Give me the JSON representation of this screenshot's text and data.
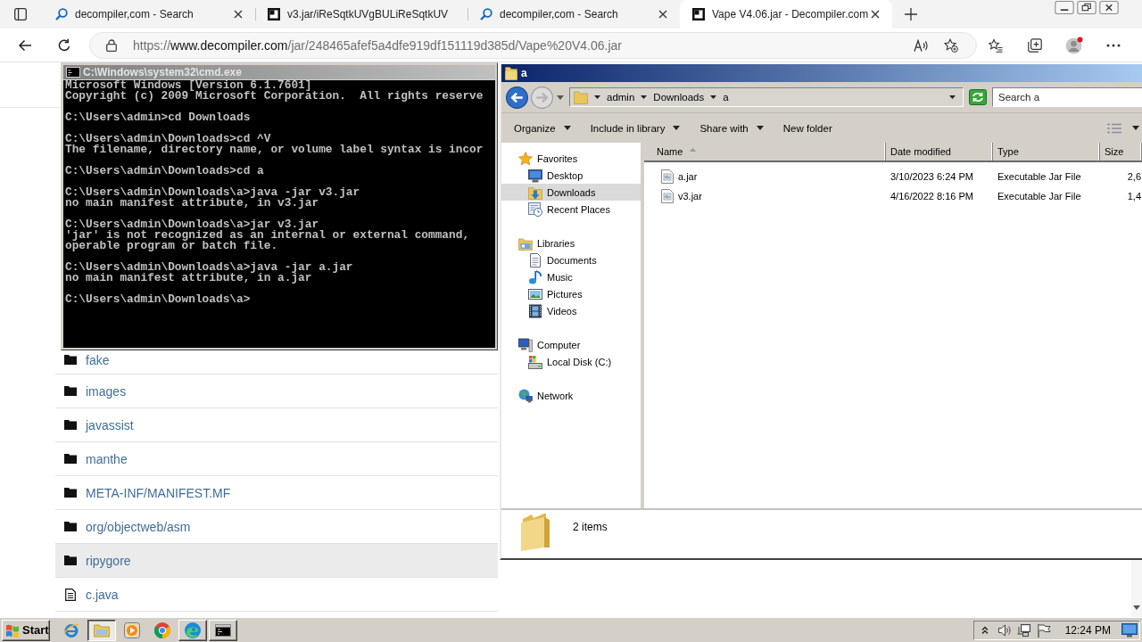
{
  "browser": {
    "tabs": [
      {
        "title": "decompiler,com - Search",
        "kind": "search",
        "selected": false,
        "closable": true
      },
      {
        "title": "v3.jar/iReSqtkUVgBULiReSqtkUV",
        "kind": "site",
        "selected": false,
        "closable": false
      },
      {
        "title": "decompiler,com - Search",
        "kind": "search",
        "selected": false,
        "closable": true
      },
      {
        "title": "Vape V4.06.jar - Decompiler.com",
        "kind": "site",
        "selected": true,
        "closable": true
      }
    ],
    "address": {
      "scheme": "https://",
      "host": "www.decompiler.com",
      "path": "/jar/248465afef5a4dfe919df151119d385d/Vape%20V4.06.jar"
    },
    "listing": [
      {
        "name": "fake",
        "kind": "folder",
        "highlighted": false
      },
      {
        "name": "images",
        "kind": "folder",
        "highlighted": false
      },
      {
        "name": "javassist",
        "kind": "folder",
        "highlighted": false
      },
      {
        "name": "manthe",
        "kind": "folder",
        "highlighted": false
      },
      {
        "name": "META-INF/MANIFEST.MF",
        "kind": "folder",
        "highlighted": false
      },
      {
        "name": "org/objectweb/asm",
        "kind": "folder",
        "highlighted": false
      },
      {
        "name": "ripygore",
        "kind": "folder",
        "highlighted": true
      },
      {
        "name": "c.java",
        "kind": "file",
        "highlighted": false
      }
    ]
  },
  "cmd": {
    "title": "C:\\Windows\\system32\\cmd.exe",
    "blocks": [
      [
        "Microsoft Windows [Version 6.1.7601]",
        "Copyright (c) 2009 Microsoft Corporation.  All rights reserve"
      ],
      [
        "C:\\Users\\admin>cd Downloads"
      ],
      [
        "C:\\Users\\admin\\Downloads>cd ^V",
        "The filename, directory name, or volume label syntax is incor"
      ],
      [
        "C:\\Users\\admin\\Downloads>cd a"
      ],
      [
        "C:\\Users\\admin\\Downloads\\a>java -jar v3.jar",
        "no main manifest attribute, in v3.jar"
      ],
      [
        "C:\\Users\\admin\\Downloads\\a>jar v3.jar",
        "'jar' is not recognized as an internal or external command,",
        "operable program or batch file."
      ],
      [
        "C:\\Users\\admin\\Downloads\\a>java -jar a.jar",
        "no main manifest attribute, in a.jar"
      ],
      [
        "C:\\Users\\admin\\Downloads\\a>"
      ]
    ]
  },
  "explorer": {
    "title": "a",
    "breadcrumb": [
      "admin",
      "Downloads",
      "a"
    ],
    "search": {
      "placeholder": "Search a"
    },
    "toolbar": [
      {
        "label": "Organize",
        "menu": true
      },
      {
        "label": "Include in library",
        "menu": true
      },
      {
        "label": "Share with",
        "menu": true
      },
      {
        "label": "New folder",
        "menu": false
      }
    ],
    "nav": [
      {
        "label": "Favorites",
        "selected": false,
        "children": [
          {
            "label": "Desktop",
            "selected": false
          },
          {
            "label": "Downloads",
            "selected": true
          },
          {
            "label": "Recent Places",
            "selected": false
          }
        ]
      },
      {
        "label": "Libraries",
        "selected": false,
        "children": [
          {
            "label": "Documents",
            "selected": false
          },
          {
            "label": "Music",
            "selected": false
          },
          {
            "label": "Pictures",
            "selected": false
          },
          {
            "label": "Videos",
            "selected": false
          }
        ]
      },
      {
        "label": "Computer",
        "selected": false,
        "children": [
          {
            "label": "Local Disk (C:)",
            "selected": false
          }
        ]
      },
      {
        "label": "Network",
        "selected": false
      }
    ],
    "columns": [
      {
        "label": "Name",
        "sorted": true
      },
      {
        "label": "Date modified",
        "sorted": false
      },
      {
        "label": "Type",
        "sorted": false
      },
      {
        "label": "Size",
        "sorted": false
      }
    ],
    "files": [
      {
        "name": "a.jar",
        "date": "3/10/2023 6:24 PM",
        "type": "Executable Jar File",
        "size": "2,6"
      },
      {
        "name": "v3.jar",
        "date": "4/16/2022 8:16 PM",
        "type": "Executable Jar File",
        "size": "1,4"
      }
    ],
    "status": "2 items"
  },
  "taskbar": {
    "start": "Start",
    "items": [
      {
        "kind": "launcher",
        "selected": false
      },
      {
        "kind": "window",
        "selected": true
      },
      {
        "kind": "launcher",
        "selected": false
      },
      {
        "kind": "launcher",
        "selected": false
      },
      {
        "kind": "window",
        "selected": false
      },
      {
        "kind": "window",
        "selected": false
      }
    ],
    "clock": "12:24 PM"
  }
}
